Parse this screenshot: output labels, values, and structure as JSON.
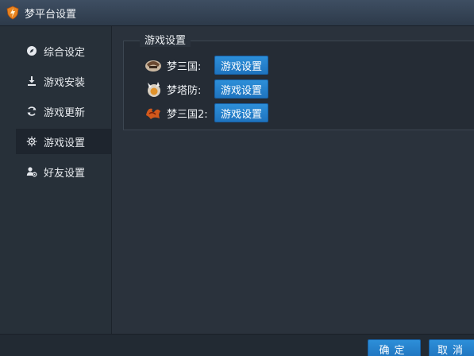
{
  "window": {
    "title": "梦平台设置",
    "app_icon": "lightning-shield-icon"
  },
  "sidebar": {
    "items": [
      {
        "label": "综合设定",
        "icon": "compass-icon",
        "active": false
      },
      {
        "label": "游戏安装",
        "icon": "download-icon",
        "active": false
      },
      {
        "label": "游戏更新",
        "icon": "refresh-icon",
        "active": false
      },
      {
        "label": "游戏设置",
        "icon": "gear-icon",
        "active": true
      },
      {
        "label": "好友设置",
        "icon": "friends-gear-icon",
        "active": false
      }
    ]
  },
  "main": {
    "group_title": "游戏设置",
    "games": [
      {
        "label": "梦三国:",
        "icon": "mengsanguo-logo-icon",
        "button": "游戏设置"
      },
      {
        "label": "梦塔防:",
        "icon": "mengtafang-logo-icon",
        "button": "游戏设置"
      },
      {
        "label": "梦三国2:",
        "icon": "mengsanguo2-logo-icon",
        "button": "游戏设置"
      }
    ]
  },
  "footer": {
    "ok_label": "确定",
    "cancel_label": "取消"
  },
  "colors": {
    "accent": "#2286d0",
    "sidebar_bg": "#273039",
    "main_bg": "#2a323c"
  }
}
